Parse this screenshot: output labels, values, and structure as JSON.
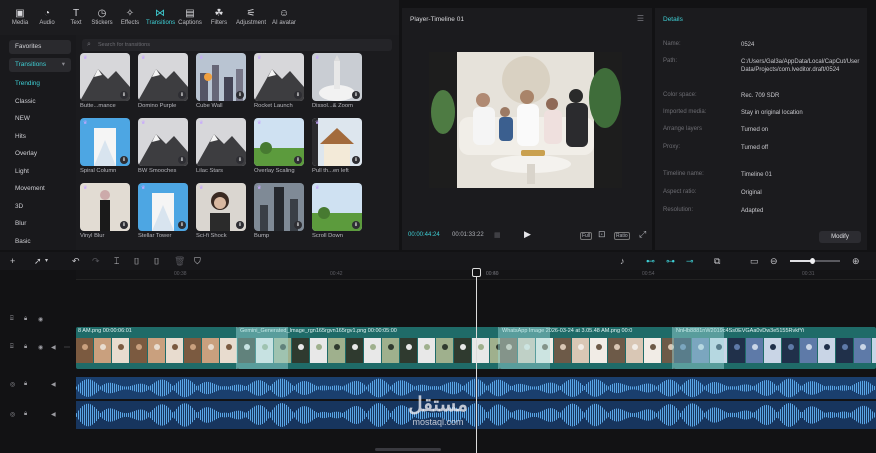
{
  "toolbar": {
    "tools": [
      {
        "label": "Media",
        "icon": "media-icon"
      },
      {
        "label": "Audio",
        "icon": "audio-icon"
      },
      {
        "label": "Text",
        "icon": "text-icon"
      },
      {
        "label": "Stickers",
        "icon": "stickers-icon"
      },
      {
        "label": "Effects",
        "icon": "effects-icon"
      },
      {
        "label": "Transitions",
        "icon": "transitions-icon",
        "active": true
      },
      {
        "label": "Captions",
        "icon": "captions-icon"
      },
      {
        "label": "Filters",
        "icon": "filters-icon"
      },
      {
        "label": "Adjustment",
        "icon": "adjustment-icon"
      },
      {
        "label": "AI avatar",
        "icon": "ai-avatar-icon"
      }
    ]
  },
  "sidebar": {
    "favorites": "Favorites",
    "transitions": "Transitions",
    "items": [
      "Trending",
      "Classic",
      "NEW",
      "Hits",
      "Overlay",
      "Light",
      "Movement",
      "3D",
      "Blur",
      "Basic"
    ]
  },
  "search": {
    "placeholder": "Search for transitions"
  },
  "tiles": [
    {
      "label": "Butte...mance",
      "scene": "mountain"
    },
    {
      "label": "Domino Purple",
      "scene": "mountain"
    },
    {
      "label": "Cube Wall",
      "scene": "city"
    },
    {
      "label": "Rocket Launch",
      "scene": "mountain"
    },
    {
      "label": "Dissol...& Zoom",
      "scene": "rocket"
    },
    {
      "label": "Spiral Column",
      "scene": "building"
    },
    {
      "label": "BW Smooches",
      "scene": "mountain"
    },
    {
      "label": "Lilac Stars",
      "scene": "mountain"
    },
    {
      "label": "Overlay Scaling",
      "scene": "field"
    },
    {
      "label": "Pull th...en left",
      "scene": "house"
    },
    {
      "label": "Vinyl Blur",
      "scene": "fashion"
    },
    {
      "label": "Stellar Tower",
      "scene": "building"
    },
    {
      "label": "Sci-fi Shock",
      "scene": "portrait"
    },
    {
      "label": "Bump",
      "scene": "tower"
    },
    {
      "label": "Scroll Down",
      "scene": "field"
    }
  ],
  "player": {
    "title": "Player-Timeline 01",
    "current_time": "00:00:44:24",
    "total_time": "00:01:33:22",
    "full_label": "Full",
    "ratio_label": "Ratio"
  },
  "details": {
    "title": "Details",
    "rows": [
      {
        "key": "Name:",
        "value": "0524"
      },
      {
        "key": "Path:",
        "value": "C:/Users/Gal3a/AppData/Local/CapCut/User Data/Projects/com.lveditor.draft/0524"
      },
      {
        "key": "Color space:",
        "value": "Rec. 709 SDR"
      },
      {
        "key": "Imported media:",
        "value": "Stay in original location"
      },
      {
        "key": "Arrange layers",
        "value": "Turned on"
      },
      {
        "key": "Proxy:",
        "value": "Turned off"
      },
      {
        "key": "Timeline name:",
        "value": "Timeline 01"
      },
      {
        "key": "Aspect ratio:",
        "value": "Original"
      },
      {
        "key": "Resolution:",
        "value": "Adapted"
      }
    ],
    "modify_label": "Modify"
  },
  "ruler": {
    "ticks": [
      "00:38",
      "00:42",
      "00:46",
      "00:50",
      "00:54",
      "00:31"
    ]
  },
  "clips": [
    {
      "label": "8 AM.png  00:00:06:01"
    },
    {
      "label": "Gemini_Generated_Image_rgn165rgvn165rgv1.png  00:00:05:00"
    },
    {
      "label": "WhatsApp Image 2026-03-24 at 3.05.48 AM.png  00:0"
    },
    {
      "label": "NnHb8881nW2019c4Ss0EVGAa0vDw3e5155RvkfYi"
    }
  ],
  "watermark": {
    "arabic": "مستقل",
    "latin": "mostaql.com"
  },
  "colors": {
    "accent": "#3fd0d6",
    "clip": "#1f6b68",
    "audio": "#1a3f6e"
  }
}
